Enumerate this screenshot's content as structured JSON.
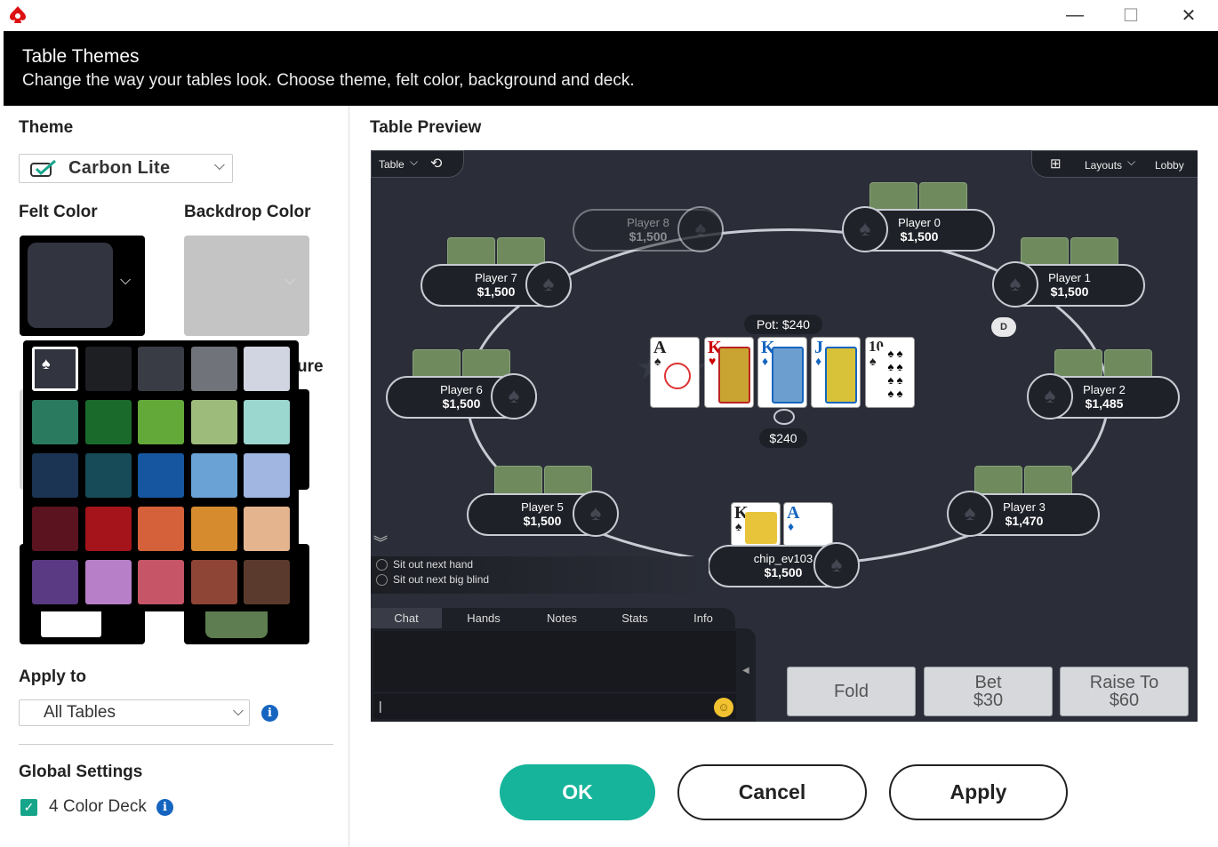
{
  "window": {
    "minimize": "—",
    "maximize": "☐",
    "close": "✕"
  },
  "header": {
    "title": "Table Themes",
    "subtitle": "Change the way your tables look. Choose theme, felt color, background and deck."
  },
  "left": {
    "theme_label": "Theme",
    "theme_value": "Carbon Lite",
    "felt_label": "Felt Color",
    "backdrop_label": "Backdrop Color",
    "partial_label": "ure",
    "apply_label": "Apply to",
    "apply_value": "All Tables",
    "global_label": "Global Settings",
    "four_color": "4 Color Deck",
    "colors": [
      [
        "#32353f",
        "#1e1f23",
        "#393c44",
        "#707379",
        "#d1d5e1"
      ],
      [
        "#2a7a60",
        "#1a6a2b",
        "#62a93a",
        "#9dbb7b",
        "#9bd6cf"
      ],
      [
        "#1c3453",
        "#174b58",
        "#1656a0",
        "#6aa2d6",
        "#a2b6e2"
      ],
      [
        "#5c1320",
        "#a5131b",
        "#d4613a",
        "#d68b2e",
        "#e3b48e"
      ],
      [
        "#5a3a82",
        "#b77fc7",
        "#c55567",
        "#8f4536",
        "#5a3a2d"
      ]
    ]
  },
  "preview": {
    "label": "Table Preview",
    "table_menu": "Table",
    "layouts": "Layouts",
    "lobby": "Lobby",
    "pot": "Pot: $240",
    "pot_amount": "$240",
    "dealer": "D",
    "players": [
      {
        "name": "Player 8",
        "stack": "$1,500"
      },
      {
        "name": "Player 0",
        "stack": "$1,500"
      },
      {
        "name": "Player 7",
        "stack": "$1,500"
      },
      {
        "name": "Player 1",
        "stack": "$1,500"
      },
      {
        "name": "Player 6",
        "stack": "$1,500"
      },
      {
        "name": "Player 2",
        "stack": "$1,485"
      },
      {
        "name": "Player 5",
        "stack": "$1,500"
      },
      {
        "name": "Player 3",
        "stack": "$1,470"
      },
      {
        "name": "chip_ev103",
        "stack": "$1,500"
      }
    ],
    "board": [
      {
        "rank": "A",
        "suit": "♠"
      },
      {
        "rank": "K",
        "suit": "♥"
      },
      {
        "rank": "K",
        "suit": "♦"
      },
      {
        "rank": "J",
        "suit": "♦"
      },
      {
        "rank": "10",
        "suit": "♠"
      }
    ],
    "hole": [
      {
        "rank": "K",
        "suit": "♠"
      },
      {
        "rank": "A",
        "suit": "♦"
      }
    ],
    "sit_out_hand": "Sit out next hand",
    "sit_out_blind": "Sit out next big blind",
    "tabs": [
      "Chat",
      "Hands",
      "Notes",
      "Stats",
      "Info"
    ],
    "chat_cursor": "|",
    "fold": "Fold",
    "bet_label": "Bet",
    "bet_amount": "$30",
    "raise_label": "Raise To",
    "raise_amount": "$60"
  },
  "buttons": {
    "ok": "OK",
    "cancel": "Cancel",
    "apply": "Apply"
  }
}
